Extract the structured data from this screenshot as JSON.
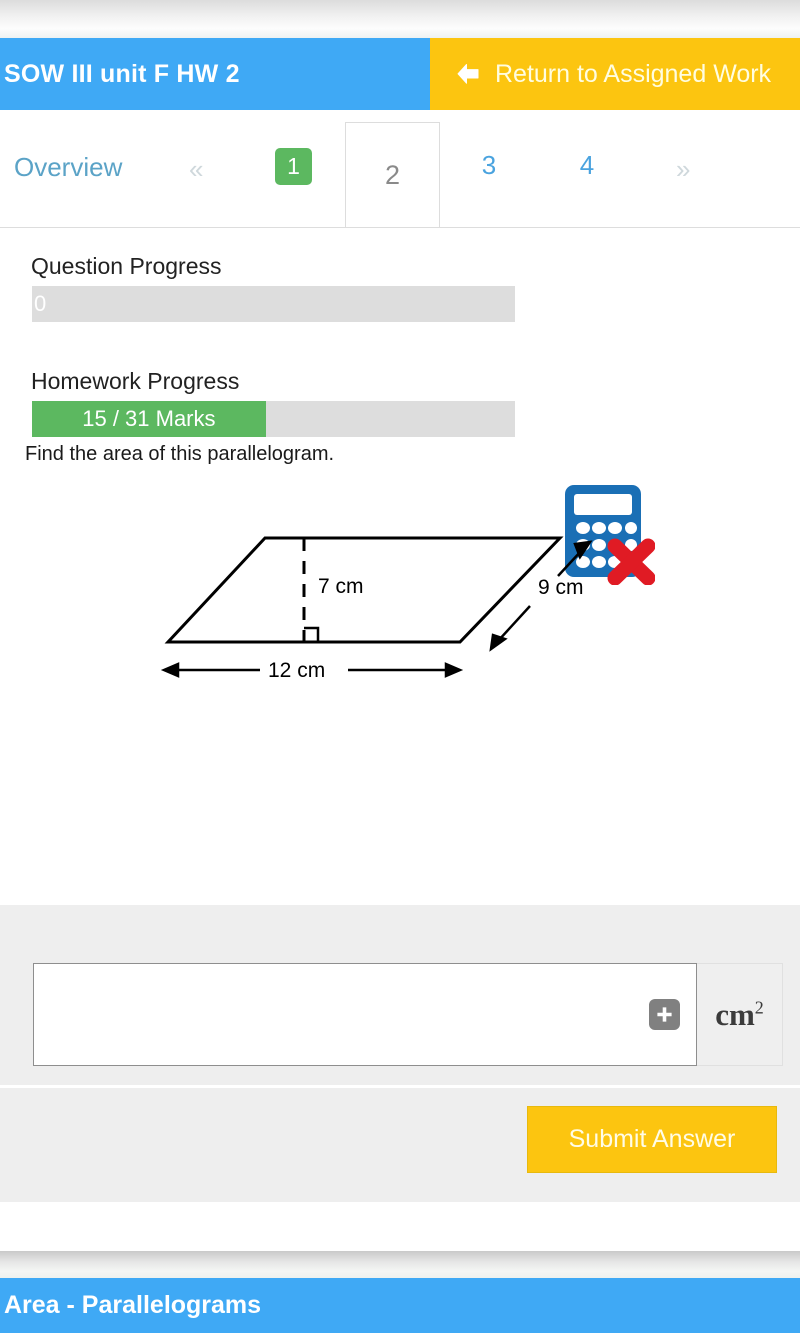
{
  "header": {
    "homework_title": "SOW III unit F HW 2",
    "return_label": "Return to Assigned Work",
    "back_arrow_icon": "arrow-left-icon",
    "title_bg": "#3fa9f5",
    "return_bg": "#fcc510"
  },
  "tabs": {
    "overview_label": "Overview",
    "prev_label": "«",
    "next_label": "»",
    "items": [
      {
        "label": "1",
        "state": "completed"
      },
      {
        "label": "2",
        "state": "active"
      },
      {
        "label": "3",
        "state": "pending"
      },
      {
        "label": "4",
        "state": "pending"
      }
    ],
    "completed_color": "#5cb860",
    "link_color": "#4aa3df"
  },
  "progress": {
    "question_label": "Question Progress",
    "question_value": "0",
    "question_percent": 0,
    "homework_label": "Homework Progress",
    "homework_value": "15 / 31 Marks",
    "homework_percent": 48.4,
    "marks_earned": 15,
    "marks_total": 31,
    "fill_color": "#5cb860",
    "track_color": "#dddddd"
  },
  "calculator": {
    "icon": "calculator-not-allowed-icon",
    "body_color": "#1a6fb5",
    "cross_color": "#e01b24"
  },
  "question": {
    "prompt": "Find the area of this parallelogram.",
    "diagram": {
      "shape": "parallelogram",
      "height_label": "7 cm",
      "base_label": "12 cm",
      "side_label": "9 cm",
      "right_angle_marker": true,
      "height_line_style": "dashed"
    }
  },
  "answer": {
    "input_value": "",
    "input_placeholder": "",
    "add_button_icon": "plus-icon",
    "unit": "cm",
    "unit_exponent": "2"
  },
  "submit": {
    "label": "Submit Answer",
    "bg": "#fcc510"
  },
  "footer": {
    "topic_title": "Area - Parallelograms",
    "bg": "#3fa9f5"
  }
}
